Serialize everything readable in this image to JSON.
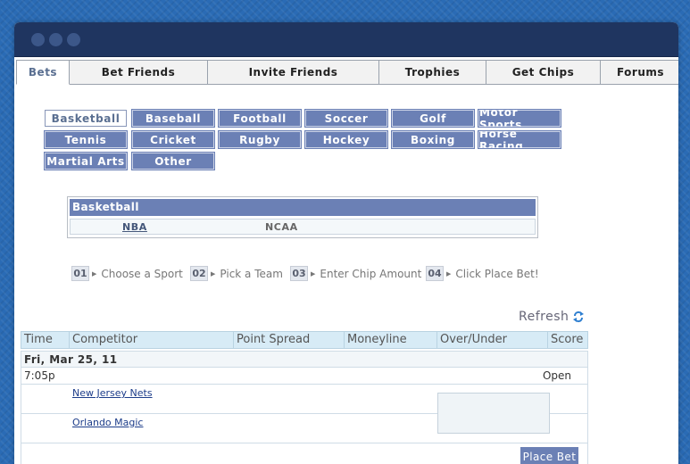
{
  "window": {
    "controls": [
      "dot",
      "dot",
      "dot"
    ]
  },
  "nav": {
    "tabs": [
      {
        "label": "Bets",
        "active": true
      },
      {
        "label": "Bet Friends"
      },
      {
        "label": "Invite Friends"
      },
      {
        "label": "Trophies"
      },
      {
        "label": "Get Chips"
      },
      {
        "label": "Forums"
      }
    ]
  },
  "sports": {
    "selected": "Basketball",
    "items": [
      "Basketball",
      "Baseball",
      "Football",
      "Soccer",
      "Golf",
      "Motor Sports",
      "Tennis",
      "Cricket",
      "Rugby",
      "Hockey",
      "Boxing",
      "Horse Racing",
      "Martial Arts",
      "Other"
    ]
  },
  "league_box": {
    "title": "Basketball",
    "leagues": [
      "NBA",
      "NCAA"
    ],
    "selected": "NBA"
  },
  "steps": [
    {
      "num": "01",
      "text": "Choose a Sport"
    },
    {
      "num": "02",
      "text": "Pick a Team"
    },
    {
      "num": "03",
      "text": "Enter Chip Amount"
    },
    {
      "num": "04",
      "text": "Click Place Bet!"
    }
  ],
  "refresh": {
    "label": "Refresh",
    "icon": "refresh-icon"
  },
  "games": {
    "columns": [
      "Time",
      "Competitor",
      "Point Spread",
      "Moneyline",
      "Over/Under",
      "Score"
    ],
    "date": "Fri, Mar 25, 11",
    "time": "7:05p",
    "status": "Open",
    "team1": "New Jersey Nets",
    "team2": "Orlando Magic",
    "place_bet": "Place Bet"
  },
  "colors": {
    "accent": "#6b80b5",
    "titlebar": "#1f3560",
    "header_bg": "#d7ebf6"
  }
}
